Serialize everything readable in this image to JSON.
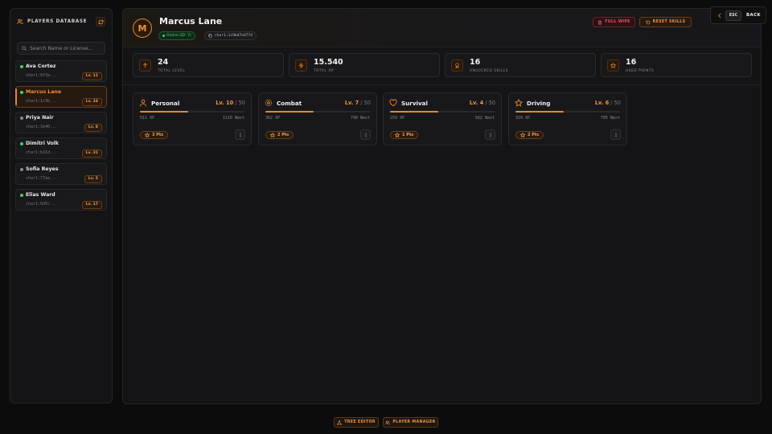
{
  "sidebar": {
    "title": "PLAYERS DATABASE",
    "search_placeholder": "Search Name or License...",
    "players": [
      {
        "name": "Ava Cortez",
        "id": "char1:0f3a...",
        "level": "Lv. 11",
        "online": true,
        "selected": false
      },
      {
        "name": "Marcus Lane",
        "id": "char1:1c9b...",
        "level": "Lv. 24",
        "online": true,
        "selected": true
      },
      {
        "name": "Priya Nair",
        "id": "char1:3e40...",
        "level": "Lv. 8",
        "online": false,
        "selected": false
      },
      {
        "name": "Dimitri Volk",
        "id": "char1:b21d...",
        "level": "Lv. 31",
        "online": true,
        "selected": false
      },
      {
        "name": "Sofia Reyes",
        "id": "char1:77aa...",
        "level": "Lv. 5",
        "online": false,
        "selected": false
      },
      {
        "name": "Elias Ward",
        "id": "char1:0d5c...",
        "level": "Lv. 17",
        "online": true,
        "selected": false
      }
    ]
  },
  "player": {
    "initial": "M",
    "name": "Marcus Lane",
    "status": "Online (ID: 7)",
    "license": "char1:1c9bd7e477d"
  },
  "actions": {
    "full_wipe": "FULL WIPE",
    "reset_skills": "RESET SKILLS"
  },
  "stats": [
    {
      "value": "24",
      "label": "TOTAL LEVEL",
      "icon": "arrow-up-icon"
    },
    {
      "value": "15.540",
      "label": "TOTAL XP",
      "icon": "bolt-icon"
    },
    {
      "value": "16",
      "label": "UNLOCKED SKILLS",
      "icon": "award-icon"
    },
    {
      "value": "16",
      "label": "USED POINTS",
      "icon": "star-icon"
    }
  ],
  "trees": [
    {
      "name": "Personal",
      "level": "Lv. 10",
      "max": "/ 50",
      "xp": "511 XP",
      "next": "1110 Next",
      "progress": 0.46,
      "points": "3 Pts",
      "icon": "user-icon"
    },
    {
      "name": "Combat",
      "level": "Lv. 7",
      "max": "/ 50",
      "xp": "362 XP",
      "next": "790 Next",
      "progress": 0.46,
      "points": "2 Pts",
      "icon": "crosshair-icon"
    },
    {
      "name": "Survival",
      "level": "Lv. 4",
      "max": "/ 50",
      "xp": "259 XP",
      "next": "562 Next",
      "progress": 0.46,
      "points": "1 Pts",
      "icon": "heart-icon"
    },
    {
      "name": "Driving",
      "level": "Lv. 6",
      "max": "/ 50",
      "xp": "324 XP",
      "next": "705 Next",
      "progress": 0.46,
      "points": "2 Pts",
      "icon": "star-icon"
    }
  ],
  "back": {
    "key": "ESC",
    "label": "BACK"
  },
  "bottom": {
    "tree_editor": "TREE EDITOR",
    "player_manager": "PLAYER MANAGER"
  },
  "colors": {
    "accent": "#e8872c",
    "online": "#3ed26a",
    "offline": "#8a8a8e",
    "danger": "#e0555c"
  }
}
